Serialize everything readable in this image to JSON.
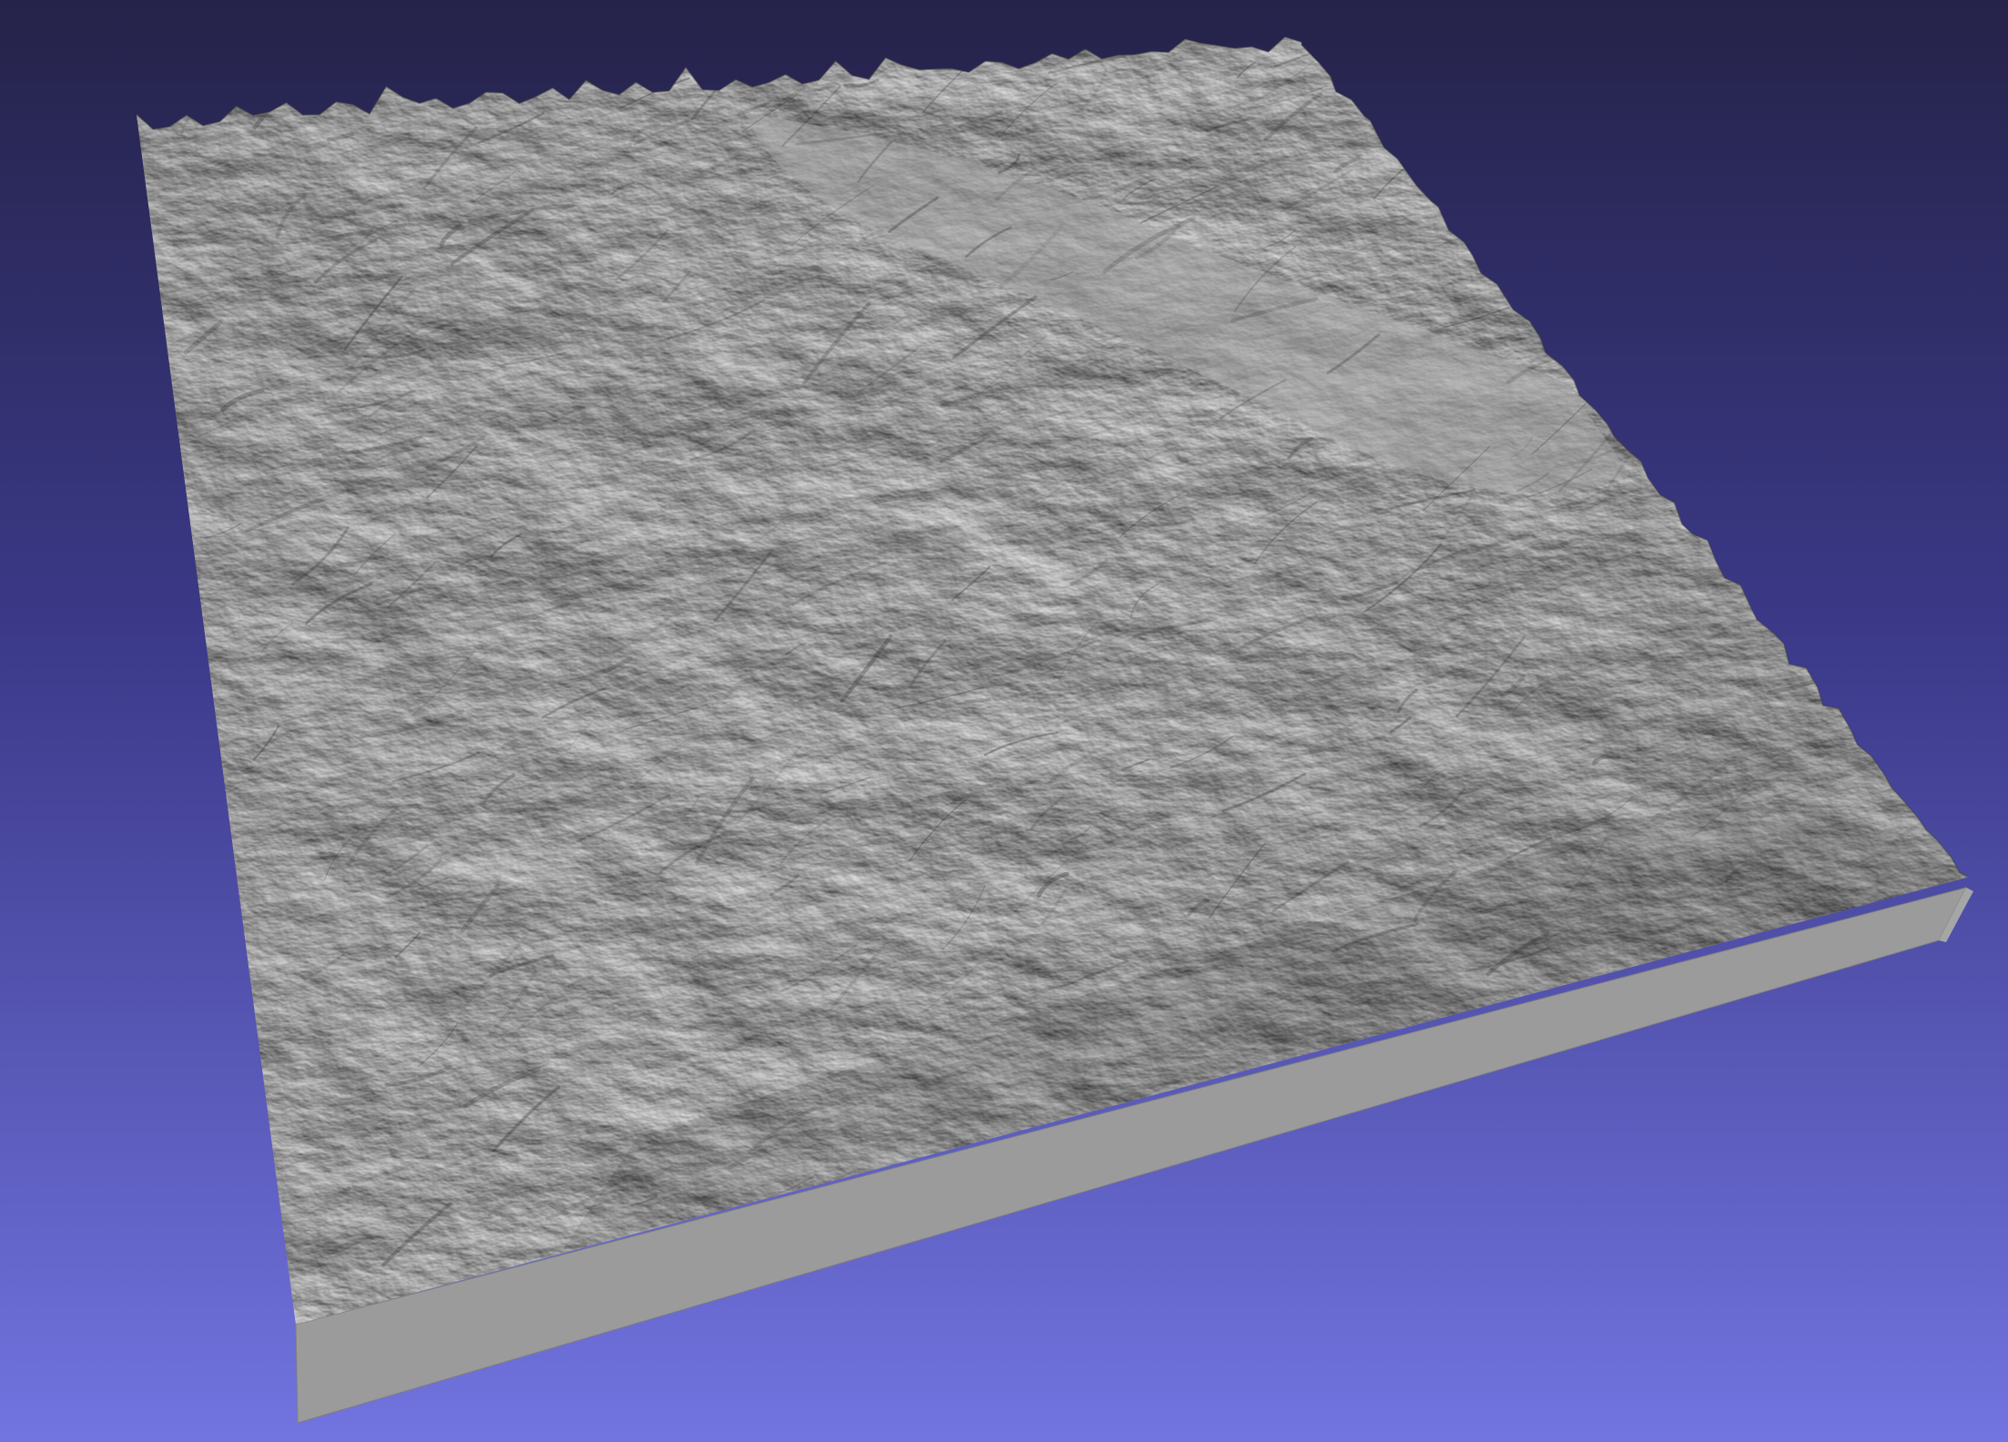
{
  "app": {
    "title": "",
    "view": "3d-viewport"
  },
  "viewport": {
    "background_gradient": {
      "top": "#252349",
      "mid": "#3c3a8a",
      "bottom": "#7274e0"
    }
  },
  "model": {
    "kind": "terrain-heightmap-mesh",
    "shading": "flat-gray-lit",
    "colors": {
      "surface_light": "#c9c9c9",
      "surface_mid": "#9a9a9a",
      "surface_dark": "#3c3c3c",
      "base_side_front": "#9b9b9b",
      "base_side_right": "#a6a6a6",
      "base_edge": "#7f7f7f"
    }
  }
}
